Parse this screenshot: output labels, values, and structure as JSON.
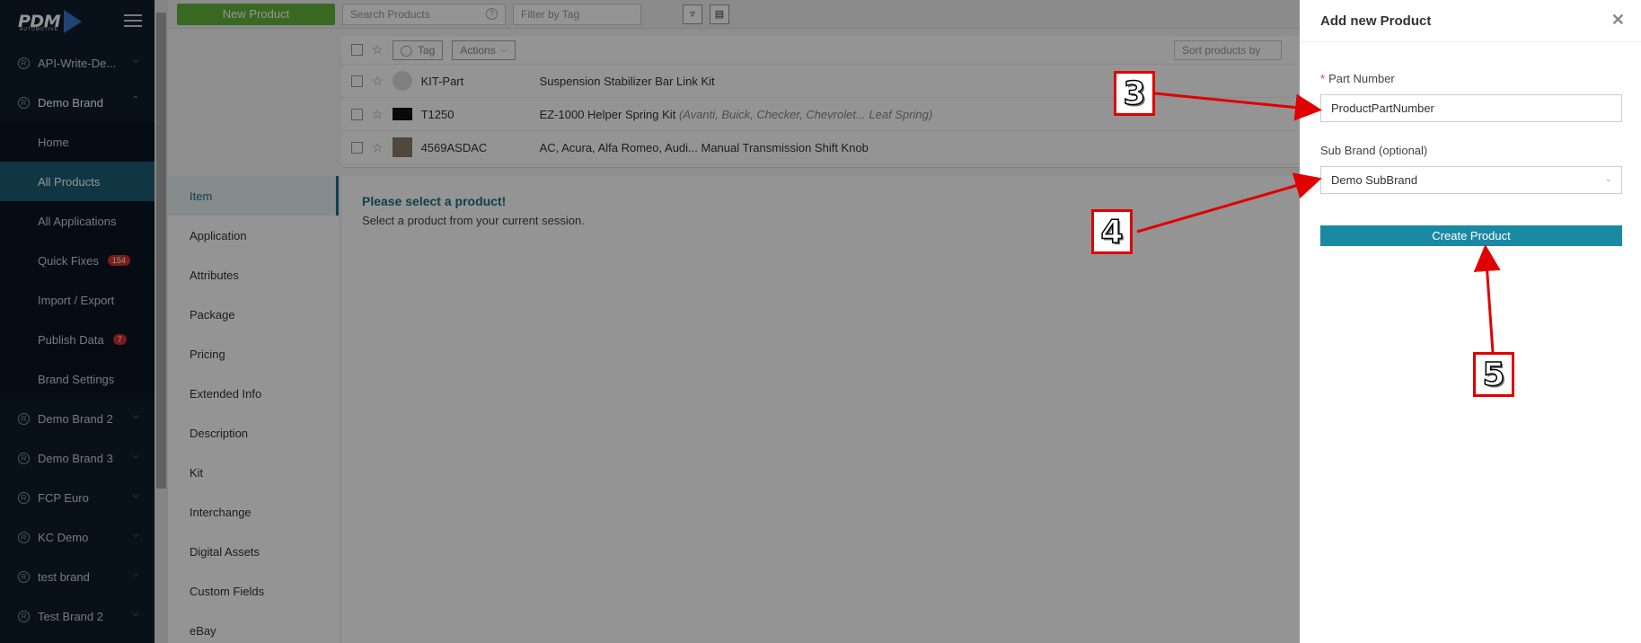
{
  "sidebar": {
    "logo": "PDM",
    "logo_sub": "AUTOMOTIVE",
    "items": [
      {
        "label": "API-Write-De...",
        "chevron": "⌄"
      },
      {
        "label": "Demo Brand",
        "chevron": "⌃"
      }
    ],
    "sub_items": [
      {
        "label": "Home"
      },
      {
        "label": "All Products"
      },
      {
        "label": "All Applications"
      },
      {
        "label": "Quick Fixes",
        "badge": "154"
      },
      {
        "label": "Import / Export"
      },
      {
        "label": "Publish Data",
        "badge": "7"
      },
      {
        "label": "Brand Settings"
      }
    ],
    "brands": [
      {
        "label": "Demo Brand 2"
      },
      {
        "label": "Demo Brand 3"
      },
      {
        "label": "FCP Euro"
      },
      {
        "label": "KC Demo"
      },
      {
        "label": "test brand"
      },
      {
        "label": "Test Brand 2"
      }
    ]
  },
  "topbar": {
    "new_product": "New Product",
    "search_placeholder": "Search Products",
    "filter_placeholder": "Filter by Tag"
  },
  "list": {
    "tag": "Tag",
    "actions": "Actions",
    "sort": "Sort products by",
    "rows": [
      {
        "pn": "KIT-Part",
        "desc": "Suspension Stabilizer Bar Link Kit",
        "extra": ""
      },
      {
        "pn": "T1250",
        "desc": "EZ-1000 Helper Spring Kit",
        "extra": "(Avanti, Buick, Checker, Chevrolet... Leaf Spring)"
      },
      {
        "pn": "4569ASDAC",
        "desc": "AC, Acura, Alfa Romeo, Audi... Manual Transmission Shift Knob",
        "extra": ""
      }
    ]
  },
  "tabs": [
    "Item",
    "Application",
    "Attributes",
    "Package",
    "Pricing",
    "Extended Info",
    "Description",
    "Kit",
    "Interchange",
    "Digital Assets",
    "Custom Fields",
    "eBay"
  ],
  "content": {
    "title": "Please select a product!",
    "text": "Select a product from your current session."
  },
  "drawer": {
    "title": "Add new Product",
    "part_number_label": "Part Number",
    "part_number_value": "ProductPartNumber",
    "sub_brand_label": "Sub Brand (optional)",
    "sub_brand_value": "Demo SubBrand",
    "create_button": "Create Product"
  },
  "annotations": {
    "step3": "3",
    "step4": "4",
    "step5": "5"
  },
  "colors": {
    "accent": "#1a8aa4",
    "new_button": "#63b33b",
    "annotation": "#e10000"
  }
}
